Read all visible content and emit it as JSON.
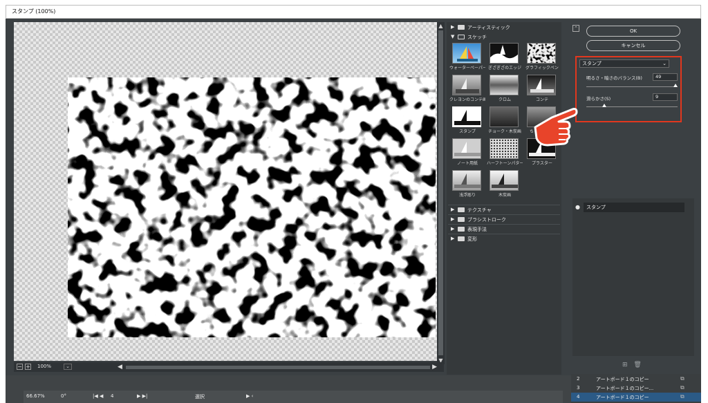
{
  "window": {
    "title": "スタンプ (100%)"
  },
  "preview": {
    "zoom": "100%",
    "zoom_out": "−",
    "zoom_in": "+"
  },
  "gallery": {
    "categories_open": [
      {
        "label": "アーティスティック",
        "expanded": false
      },
      {
        "label": "スケッチ",
        "expanded": true
      }
    ],
    "thumbnails": [
      {
        "label": "ウォーターペーパー"
      },
      {
        "label": "ぎざぎざのエッジ"
      },
      {
        "label": "グラフィックペン"
      },
      {
        "label": "クレヨンのコンテ画"
      },
      {
        "label": "クロム"
      },
      {
        "label": "コンテ"
      },
      {
        "label": "スタンプ",
        "selected": true
      },
      {
        "label": "チョーク・木炭画"
      },
      {
        "label": "ちりめんじわ"
      },
      {
        "label": "ノート用紙"
      },
      {
        "label": "ハーフトーンパターン"
      },
      {
        "label": "プラスター"
      },
      {
        "label": "浅浮彫り"
      },
      {
        "label": "木炭画"
      }
    ],
    "categories_closed": [
      {
        "label": "テクスチャ"
      },
      {
        "label": "ブラシストローク"
      },
      {
        "label": "表現手法"
      },
      {
        "label": "変形"
      }
    ]
  },
  "settings": {
    "ok_label": "OK",
    "cancel_label": "キャンセル",
    "filter_select": "スタンプ",
    "params": [
      {
        "label": "明るさ・暗さのバランス(B)",
        "value": "49",
        "fraction": 0.98
      },
      {
        "label": "滑らかさ(S)",
        "value": "9",
        "fraction": 0.2
      }
    ],
    "layer_name": "スタンプ",
    "new_layer_icon": "add-icon",
    "delete_layer_icon": "trash-icon"
  },
  "statusbar": {
    "zoom": "66.67%",
    "rotation": "0°",
    "page": "4",
    "mode": "選択"
  },
  "pages": [
    {
      "num": "2",
      "name": "アートボード１のコピー"
    },
    {
      "num": "3",
      "name": "アートボード１のコピー..."
    },
    {
      "num": "4",
      "name": "アートボード１のコピー",
      "selected": true
    }
  ],
  "colors": {
    "highlight": "#e2371e",
    "panel": "#3b4043",
    "accent_hand": "#e8442a"
  }
}
